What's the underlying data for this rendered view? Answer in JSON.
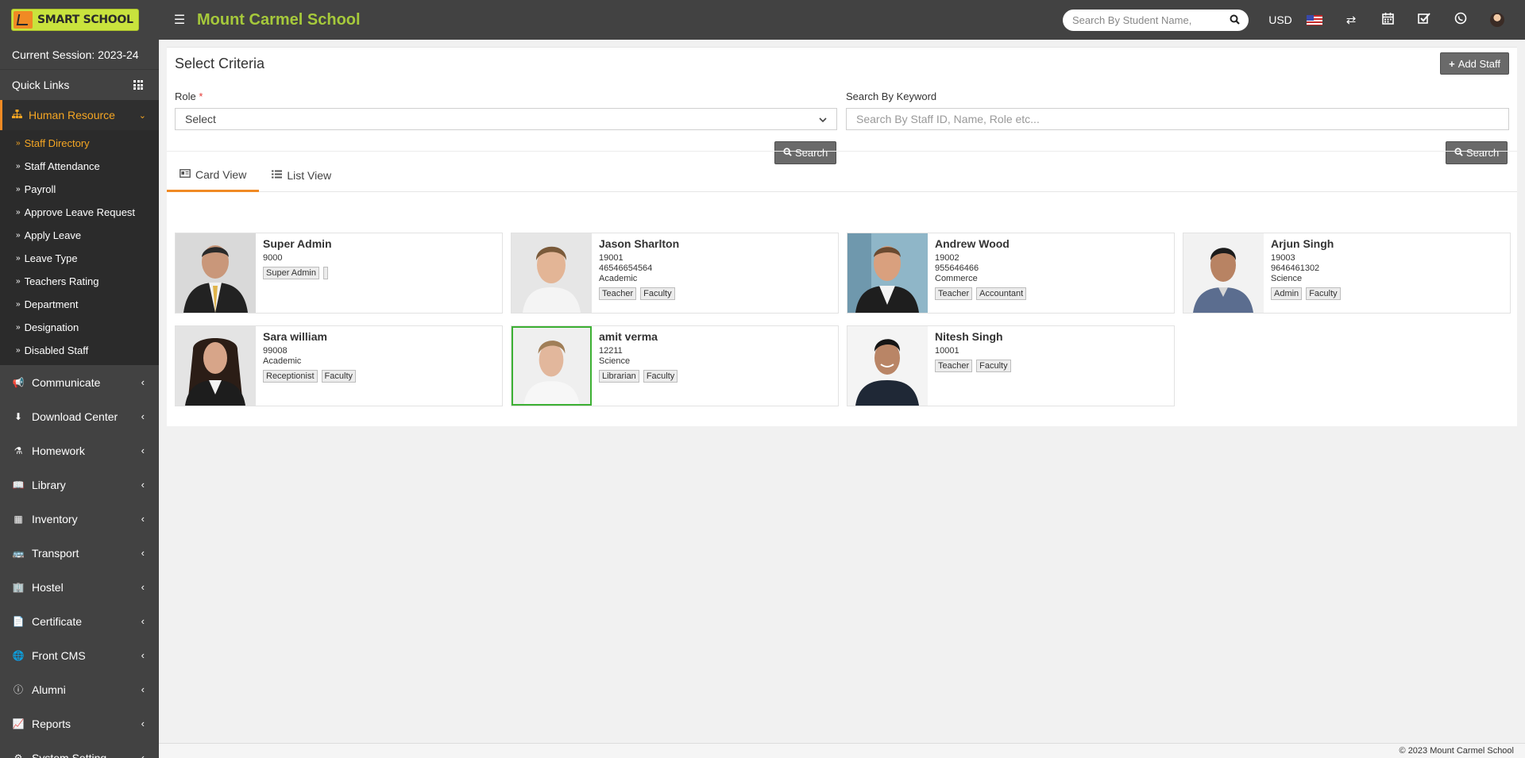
{
  "header": {
    "logo_text": "SMART SCHOOL",
    "school_name": "Mount Carmel School",
    "search_placeholder": "Search By Student Name,",
    "currency": "USD"
  },
  "sidebar": {
    "session": "Current Session: 2023-24",
    "quick_links": "Quick Links",
    "active_menu": "Human Resource",
    "submenu": [
      "Staff Directory",
      "Staff Attendance",
      "Payroll",
      "Approve Leave Request",
      "Apply Leave",
      "Leave Type",
      "Teachers Rating",
      "Department",
      "Designation",
      "Disabled Staff"
    ],
    "menu": [
      {
        "label": "Communicate",
        "icon": "bullhorn-icon"
      },
      {
        "label": "Download Center",
        "icon": "download-icon"
      },
      {
        "label": "Homework",
        "icon": "flask-icon"
      },
      {
        "label": "Library",
        "icon": "book-icon"
      },
      {
        "label": "Inventory",
        "icon": "inventory-icon"
      },
      {
        "label": "Transport",
        "icon": "bus-icon"
      },
      {
        "label": "Hostel",
        "icon": "building-icon"
      },
      {
        "label": "Certificate",
        "icon": "certificate-icon"
      },
      {
        "label": "Front CMS",
        "icon": "globe-icon"
      },
      {
        "label": "Alumni",
        "icon": "info-icon"
      },
      {
        "label": "Reports",
        "icon": "chart-icon"
      },
      {
        "label": "System Setting",
        "icon": "cogs-icon"
      }
    ]
  },
  "criteria": {
    "title": "Select Criteria",
    "add_staff": "Add Staff",
    "role_label": "Role",
    "required_mark": "*",
    "role_value": "Select",
    "keyword_label": "Search By Keyword",
    "keyword_placeholder": "Search By Staff ID, Name, Role etc...",
    "search_button": "Search"
  },
  "tabs": {
    "card_view": "Card View",
    "list_view": "List View"
  },
  "staff": [
    {
      "name": "Super Admin",
      "lines": [
        "9000"
      ],
      "tags": [
        "Super Admin",
        ""
      ]
    },
    {
      "name": "Jason Sharlton",
      "lines": [
        "19001",
        "46546654564",
        "Academic"
      ],
      "tags": [
        "Teacher",
        "Faculty"
      ]
    },
    {
      "name": "Andrew Wood",
      "lines": [
        "19002",
        "955646466",
        "Commerce"
      ],
      "tags": [
        "Teacher",
        "Accountant"
      ]
    },
    {
      "name": "Arjun Singh",
      "lines": [
        "19003",
        "9646461302",
        "Science"
      ],
      "tags": [
        "Admin",
        "Faculty"
      ]
    },
    {
      "name": "Sara william",
      "lines": [
        "99008",
        "Academic"
      ],
      "tags": [
        "Receptionist",
        "Faculty"
      ]
    },
    {
      "name": "amit verma",
      "lines": [
        "12211",
        "Science"
      ],
      "tags": [
        "Librarian",
        "Faculty"
      ]
    },
    {
      "name": "Nitesh Singh",
      "lines": [
        "10001"
      ],
      "tags": [
        "Teacher",
        "Faculty"
      ]
    }
  ],
  "footer": "© 2023 Mount Carmel School"
}
